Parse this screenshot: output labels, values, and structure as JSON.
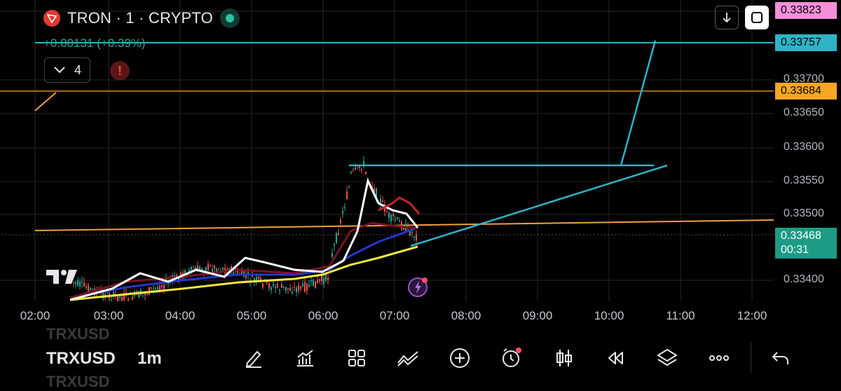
{
  "header": {
    "title": "TRON · 1 · CRYPTO",
    "change": "+0.00131 (+0.39%)",
    "indicator_count": "4",
    "alert_symbol": "!"
  },
  "price_scale": {
    "ticks": [
      "0.33700",
      "0.33650",
      "0.33600",
      "0.33550",
      "0.33500",
      "0.33400"
    ],
    "tags": {
      "high": "0.33823",
      "line_teal": "0.33757",
      "line_orange": "0.33684",
      "last": "0.33468",
      "countdown": "00:31"
    }
  },
  "time_axis": [
    "02:00",
    "03:00",
    "04:00",
    "05:00",
    "06:00",
    "07:00",
    "08:00",
    "09:00",
    "10:00",
    "11:00",
    "12:00"
  ],
  "toolbar": {
    "symbol": "TRXUSD",
    "interval": "1m",
    "icons": [
      "pencil-icon",
      "chart-bars-icon",
      "grid-icon",
      "pattern-icon",
      "plus-circle-icon",
      "alarm-clock-icon",
      "candlestick-icon",
      "rewind-icon",
      "layers-icon",
      "more-icon",
      "undo-icon"
    ]
  },
  "colors": {
    "background": "#000000",
    "teal": "#2fb3c6",
    "orange": "#f0a040",
    "pink_tag": "#f48fd8",
    "green_tag": "#1e9b85",
    "up": "#26a69a",
    "down": "#ef5350"
  }
}
